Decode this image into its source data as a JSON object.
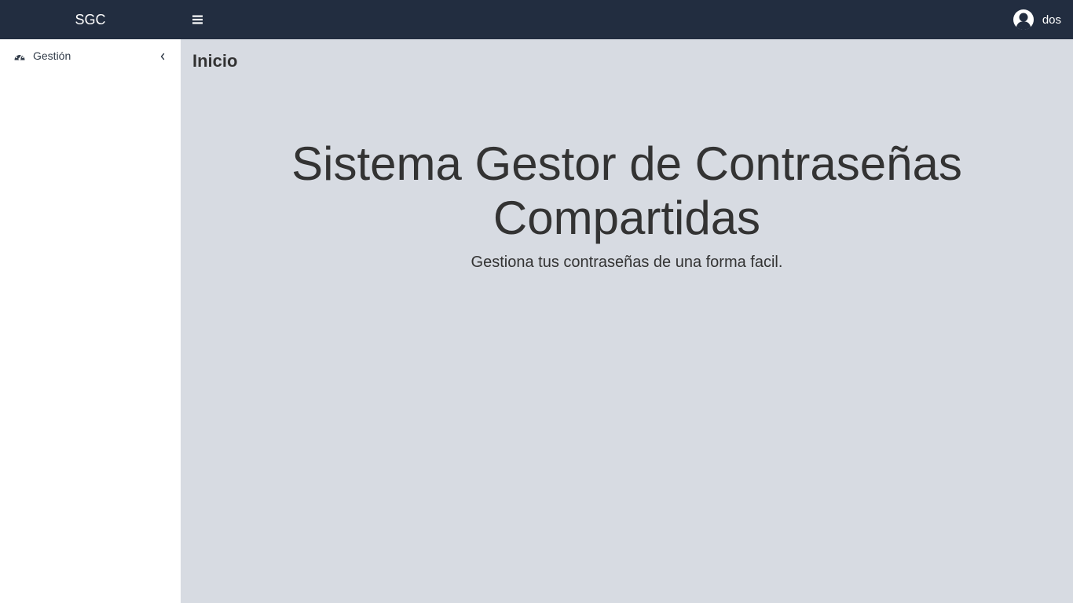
{
  "header": {
    "brand": "SGC",
    "user_name": "dos",
    "menu_icon": "hamburger-icon",
    "avatar_icon": "user-avatar-icon"
  },
  "sidebar": {
    "items": [
      {
        "label": "Gestión",
        "icon": "dashboard-icon",
        "chevron": "chevron-left-icon"
      }
    ]
  },
  "main": {
    "page_title": "Inicio",
    "hero_title": "Sistema Gestor de Contraseñas Compartidas",
    "hero_subtitle": "Gestiona tus contraseñas de una forma facil."
  },
  "colors": {
    "topbar": "#222d40",
    "sidebar": "#ffffff",
    "content": "#d7dbe2",
    "text": "#333333"
  }
}
